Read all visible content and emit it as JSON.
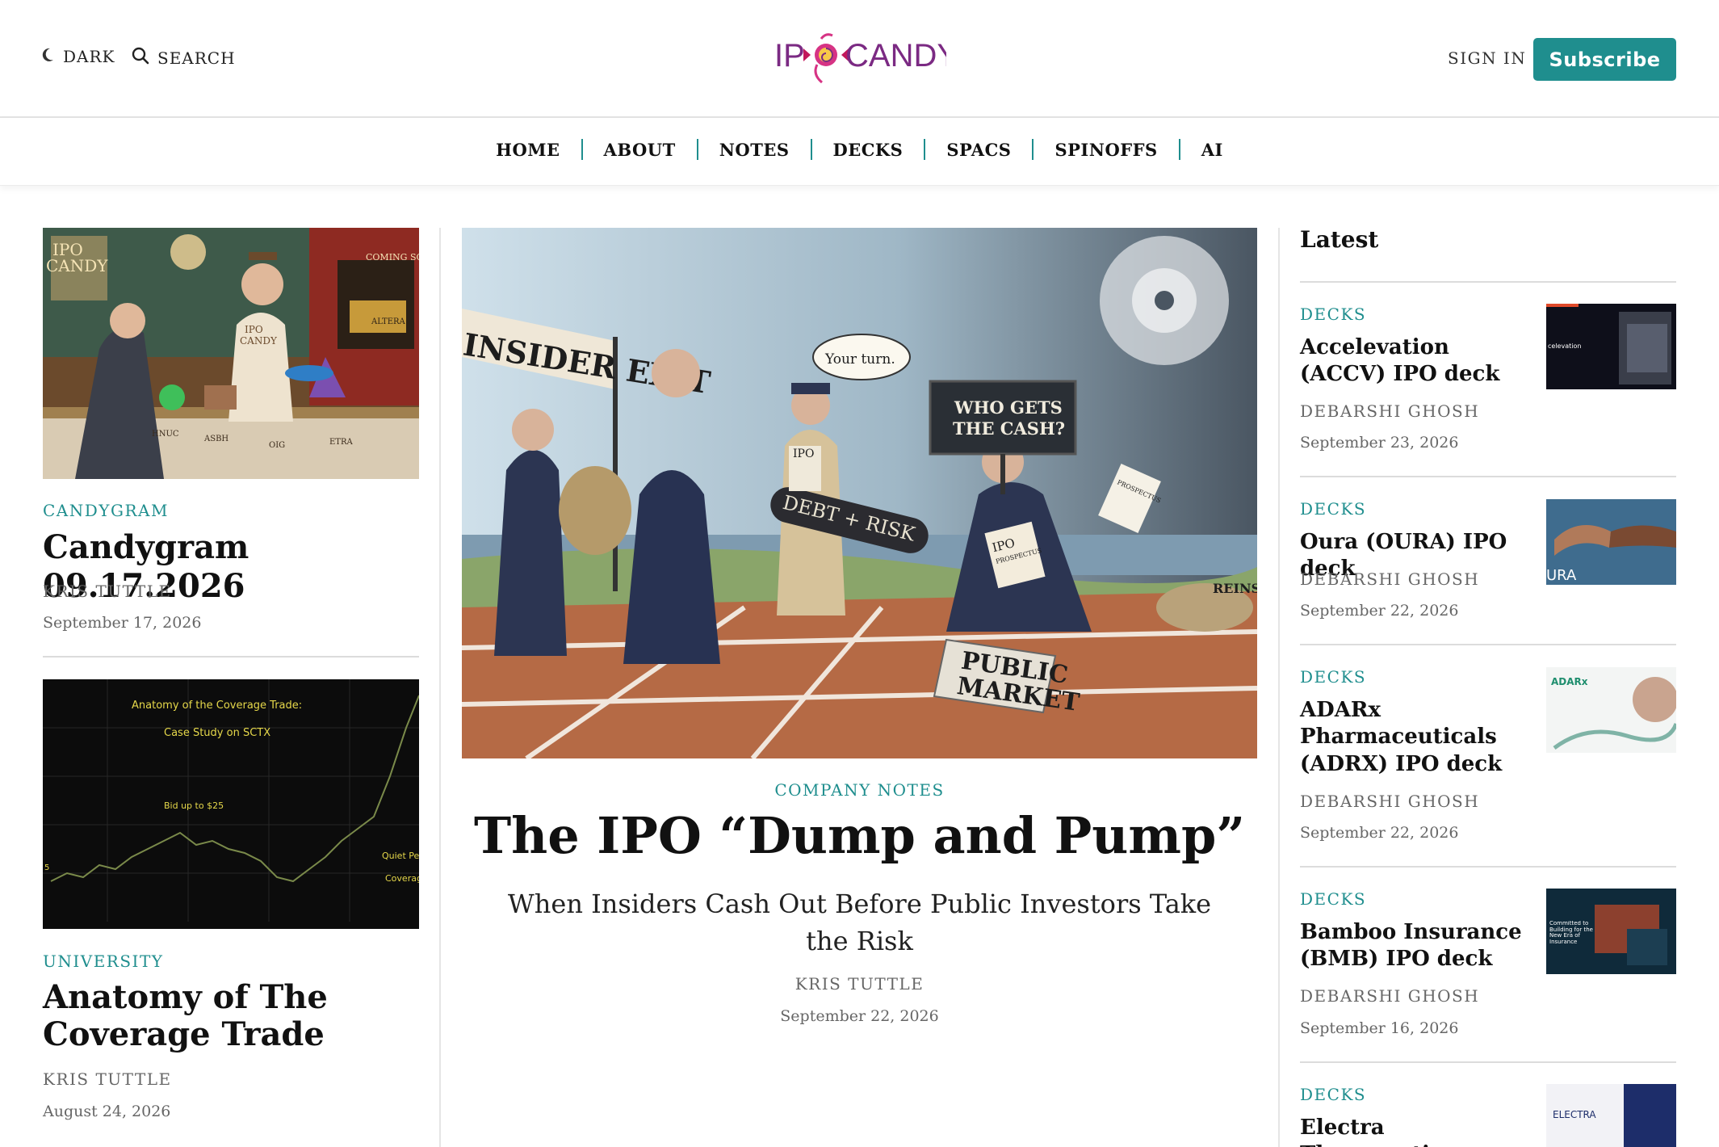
{
  "header": {
    "dark_label": "DARK",
    "search_label": "SEARCH",
    "logo_text_left": "IP",
    "logo_text_right": "CANDY",
    "sign_in_label": "SIGN IN",
    "subscribe_label": "Subscribe"
  },
  "nav": {
    "items": [
      {
        "label": "HOME"
      },
      {
        "label": "ABOUT"
      },
      {
        "label": "NOTES"
      },
      {
        "label": "DECKS"
      },
      {
        "label": "SPACS"
      },
      {
        "label": "SPINOFFS"
      },
      {
        "label": "AI"
      }
    ]
  },
  "left": {
    "post1": {
      "category": "CANDYGRAM",
      "title": "Candygram 09.17.2026",
      "author": "KRIS TUTTLE",
      "date": "September 17, 2026",
      "image_text": [
        "IPO",
        "CANDY",
        "COMING SOON",
        "ALTERA",
        "HNUC",
        "ASBH",
        "OIG",
        "ETRA",
        "IPO",
        "CANDY"
      ]
    },
    "post2": {
      "category": "UNIVERSITY",
      "title": "Anatomy of The Coverage Trade",
      "author": "KRIS TUTTLE",
      "date": "August 24, 2026",
      "image_text": [
        "Anatomy of the Coverage Trade:",
        "Case Study on SCTX",
        "Bid up to $25",
        "Quiet Per",
        "Coverage",
        "5"
      ]
    }
  },
  "featured": {
    "category": "COMPANY NOTES",
    "title": "The IPO “Dump and Pump”",
    "subtitle": "When Insiders Cash Out Before Public Investors Take the Risk",
    "author": "KRIS TUTTLE",
    "date": "September 22, 2026",
    "image_text": [
      "INSIDER EXIT",
      "Your turn.",
      "IPO",
      "WHO GETS",
      "THE CASH?",
      "DEBT + RISK",
      "IPO",
      "PROSPECTUS",
      "PUBLIC",
      "MARKET",
      "PROSPECTUS",
      "REINSU"
    ]
  },
  "latest": {
    "heading": "Latest",
    "items": [
      {
        "category": "DECKS",
        "title": "Accelevation (ACCV) IPO deck",
        "author": "DEBARSHI GHOSH",
        "date": "September 23, 2026",
        "thumb_text": "celevation"
      },
      {
        "category": "DECKS",
        "title": "Oura (OURA) IPO deck",
        "author": "DEBARSHI GHOSH",
        "date": "September 22, 2026",
        "thumb_text": "URA"
      },
      {
        "category": "DECKS",
        "title": "ADARx Pharmaceuticals (ADRX) IPO deck",
        "author": "DEBARSHI GHOSH",
        "date": "September 22, 2026",
        "thumb_text": "ADARx"
      },
      {
        "category": "DECKS",
        "title": "Bamboo Insurance (BMB) IPO deck",
        "author": "DEBARSHI GHOSH",
        "date": "September 16, 2026",
        "thumb_text": "Committed to Building for the New Era of Insurance"
      },
      {
        "category": "DECKS",
        "title": "Electra Therapeutics",
        "thumb_text": "ELECTRA"
      }
    ]
  },
  "colors": {
    "accent": "#1f8e8e",
    "logo_purple": "#7b2a83",
    "logo_pink": "#d63384"
  }
}
